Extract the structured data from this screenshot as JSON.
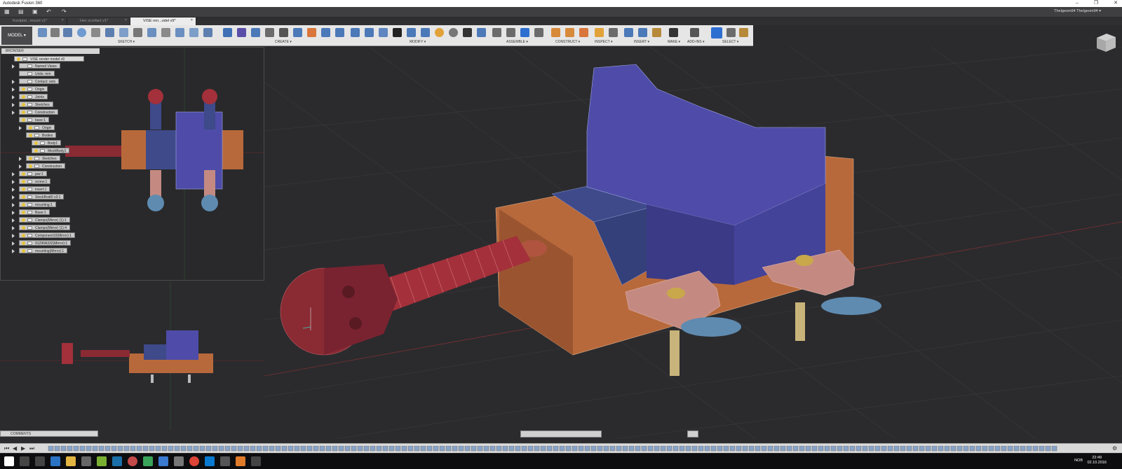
{
  "window": {
    "title": "Autodesk Fusion 360",
    "minimize": "–",
    "maximize": "❐",
    "close": "✕"
  },
  "user": {
    "name": "Thelgeom94 Thelgeom94 ▾"
  },
  "tabs": [
    {
      "label": "frontplat...mount v1*",
      "close": "×"
    },
    {
      "label": "Hex screfact v1*",
      "close": "×"
    },
    {
      "label": "VISE ren...odel v9*",
      "close": "×"
    }
  ],
  "toolbar": {
    "workspace": "MODEL ▾",
    "groups": [
      "SKETCH ▾",
      "CREATE ▾",
      "MODIFY ▾",
      "ASSEMBLE ▾",
      "CONSTRUCT ▾",
      "INSPECT ▾",
      "INSERT ▾",
      "MAKE ▾",
      "ADD-INS ▾",
      "SELECT ▾"
    ]
  },
  "browser": {
    "title": "BROWSER",
    "root": "VISE render model v9",
    "items": [
      {
        "label": "Named Views"
      },
      {
        "label": "Units: mm"
      },
      {
        "label": "Contact: sets"
      },
      {
        "label": "Origin"
      },
      {
        "label": "Joints"
      },
      {
        "label": "Sketches"
      },
      {
        "label": "Construction"
      },
      {
        "label": "base:1"
      },
      {
        "label": "Origin"
      },
      {
        "label": "Bodies"
      },
      {
        "label": "Body1"
      },
      {
        "label": "MeshBody1"
      },
      {
        "label": "Sketches"
      },
      {
        "label": "Construction"
      },
      {
        "label": "jaw:1"
      },
      {
        "label": "screw:1"
      },
      {
        "label": "insert:1"
      },
      {
        "label": "StockBodt0 v3:1"
      },
      {
        "label": "mounting:1"
      },
      {
        "label": "Base:1"
      },
      {
        "label": "Clamps(Mirror) (1):1"
      },
      {
        "label": "Clamps(Mirror) (1):4"
      },
      {
        "label": "Component10(Mirror):1"
      },
      {
        "label": "91290A332(Mirror):1"
      },
      {
        "label": "mounting(Mirror):1"
      }
    ]
  },
  "comments": {
    "label": "COMMENTS"
  },
  "taskbar": {
    "lang": "NOB",
    "time": "22:49",
    "date": "02.10.2016"
  },
  "colors": {
    "jaw": "#4a4a9e",
    "base": "#b86a3d",
    "screw": "#8a2a33",
    "foot": "#5a7d9a",
    "pin": "#c8b47a"
  }
}
